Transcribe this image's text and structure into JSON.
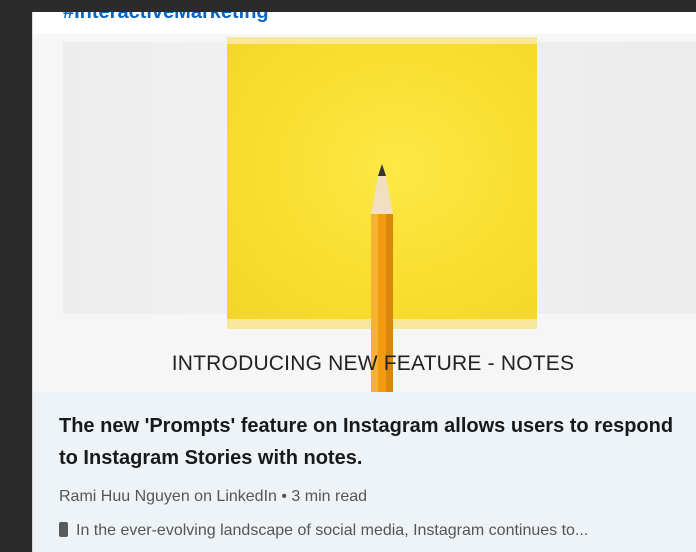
{
  "post": {
    "hashtag": "#InteractiveMarketing"
  },
  "article": {
    "image_caption": "INTRODUCING NEW FEATURE - NOTES",
    "title": "The new 'Prompts' feature on Instagram allows users to respond to Instagram Stories with notes.",
    "author_source": "Rami Huu Nguyen on LinkedIn",
    "separator": "•",
    "read_time": "3 min read",
    "snippet_icon": "mobile-phone-icon",
    "snippet": "In the ever-evolving landscape of social media, Instagram continues to..."
  },
  "colors": {
    "link": "#0a66c2",
    "sticky_note": "#f9dd2e",
    "pencil": "#f39c12",
    "text_panel": "#eef3f8"
  }
}
